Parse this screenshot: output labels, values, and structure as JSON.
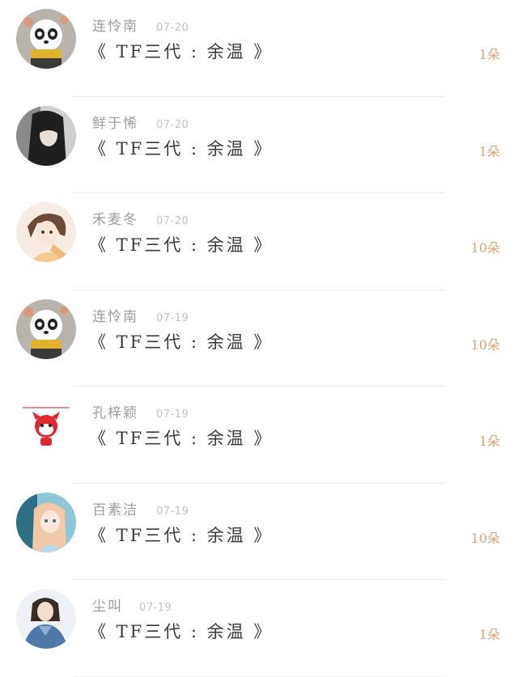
{
  "items": [
    {
      "name": "连怜南",
      "date": "07-20",
      "title": "《 TF三代 : 余温 》",
      "count": "1朵",
      "avatar": "panda-avatar"
    },
    {
      "name": "鲜于悕",
      "date": "07-20",
      "title": "《 TF三代 : 余温 》",
      "count": "1朵",
      "avatar": "dark-hair-girl-avatar"
    },
    {
      "name": "禾麦冬",
      "date": "07-20",
      "title": "《 TF三代 : 余温 》",
      "count": "10朵",
      "avatar": "anime-girl-avatar"
    },
    {
      "name": "连怜南",
      "date": "07-19",
      "title": "《 TF三代 : 余温 》",
      "count": "10朵",
      "avatar": "panda-avatar"
    },
    {
      "name": "孔梓颖",
      "date": "07-19",
      "title": "《 TF三代 : 余温 》",
      "count": "1朵",
      "avatar": "red-fox-avatar"
    },
    {
      "name": "百素洁",
      "date": "07-19",
      "title": "《 TF三代 : 余温 》",
      "count": "10朵",
      "avatar": "blue-anime-girl-avatar"
    },
    {
      "name": "尘叫",
      "date": "07-19",
      "title": "《 TF三代 : 余温 》",
      "count": "1朵",
      "avatar": "denim-girl-avatar"
    }
  ],
  "colors": {
    "count_accent": "#e0a271",
    "name_gray": "#9c9c9c",
    "title_dark": "#3a3a3a"
  }
}
